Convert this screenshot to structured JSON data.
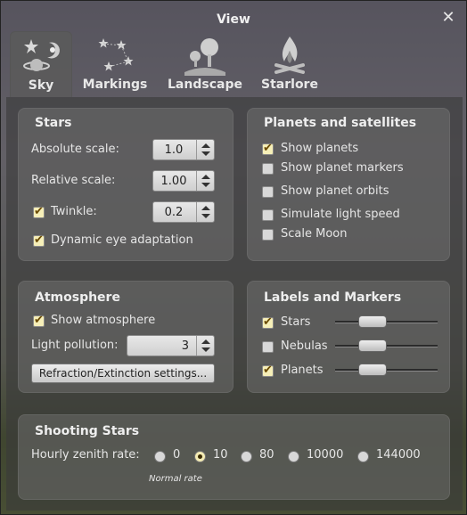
{
  "window": {
    "title": "View"
  },
  "tabs": [
    {
      "label": "Sky",
      "icon": "sky-icon",
      "active": true
    },
    {
      "label": "Markings",
      "icon": "constellation-icon"
    },
    {
      "label": "Landscape",
      "icon": "trees-icon"
    },
    {
      "label": "Starlore",
      "icon": "campfire-icon"
    }
  ],
  "stars": {
    "title": "Stars",
    "absolute_scale_label": "Absolute scale:",
    "absolute_scale_value": "1.0",
    "relative_scale_label": "Relative scale:",
    "relative_scale_value": "1.00",
    "twinkle_label": "Twinkle:",
    "twinkle_checked": true,
    "twinkle_value": "0.2",
    "dynamic_eye_label": "Dynamic eye adaptation",
    "dynamic_eye_checked": true
  },
  "planets": {
    "title": "Planets and satellites",
    "items": [
      {
        "label": "Show planets",
        "checked": true
      },
      {
        "label": "Show planet markers",
        "checked": false
      },
      {
        "label": "Show planet orbits",
        "checked": false
      },
      {
        "label": "Simulate light speed",
        "checked": false
      },
      {
        "label": "Scale Moon",
        "checked": false
      }
    ]
  },
  "atmosphere": {
    "title": "Atmosphere",
    "show_label": "Show atmosphere",
    "show_checked": true,
    "light_pollution_label": "Light pollution:",
    "light_pollution_value": "3",
    "refraction_button": "Refraction/Extinction settings..."
  },
  "labels": {
    "title": "Labels and Markers",
    "items": [
      {
        "label": "Stars",
        "checked": true,
        "level": 0.35
      },
      {
        "label": "Nebulas",
        "checked": false,
        "level": 0.35
      },
      {
        "label": "Planets",
        "checked": true,
        "level": 0.35
      }
    ]
  },
  "shooting": {
    "title": "Shooting Stars",
    "rate_label": "Hourly zenith rate:",
    "options": [
      "0",
      "10",
      "80",
      "10000",
      "144000"
    ],
    "selected": "10",
    "note": "Normal rate"
  },
  "colors": {
    "accent_check": "#f6efb8",
    "panel": "#3a3a3a"
  }
}
